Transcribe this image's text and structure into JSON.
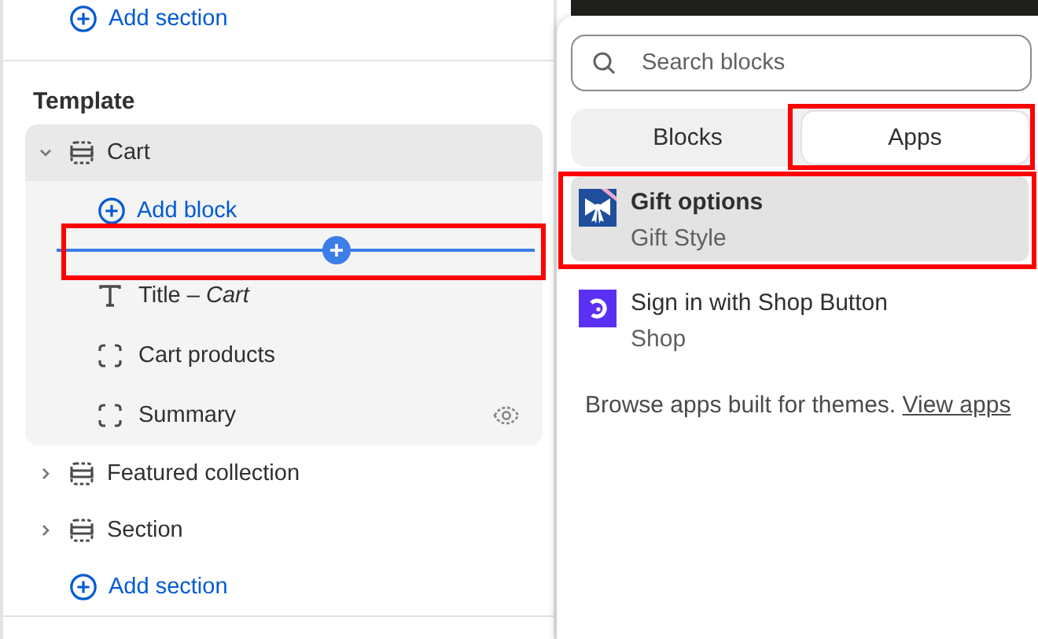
{
  "sidebar": {
    "top_add_section": "Add section",
    "heading": "Template",
    "sections": [
      {
        "name": "Cart",
        "expanded": true,
        "selected": true,
        "add_block": "Add block",
        "insert_marker": {
          "highlighted": true
        },
        "blocks": [
          {
            "kind": "text",
            "label": "Title – *Cart*",
            "visibility_icon": false
          },
          {
            "kind": "block",
            "label": "Cart products",
            "visibility_icon": false
          },
          {
            "kind": "block",
            "label": "Summary",
            "visibility_icon": true
          }
        ]
      },
      {
        "name": "Featured collection",
        "expanded": false,
        "selected": false
      },
      {
        "name": "Section",
        "expanded": false,
        "selected": false
      }
    ],
    "bottom_add_section": "Add section"
  },
  "picker": {
    "search": {
      "placeholder": "Search blocks"
    },
    "tabs": [
      {
        "label": "Blocks",
        "selected": false,
        "highlighted": false
      },
      {
        "label": "Apps",
        "selected": true,
        "highlighted": true
      }
    ],
    "apps": [
      {
        "kind": "gift",
        "title": "Gift options",
        "subtitle": "Gift Style",
        "selected": true,
        "highlighted": true
      },
      {
        "kind": "shop",
        "title": "Sign in with Shop Button",
        "subtitle": "Shop",
        "selected": false,
        "highlighted": false
      }
    ],
    "footer": {
      "text": "Browse apps built for themes.",
      "link": "View apps"
    }
  }
}
